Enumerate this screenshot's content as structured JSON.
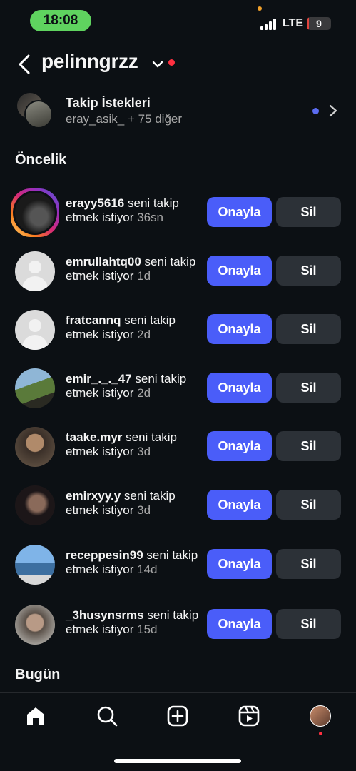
{
  "status": {
    "time": "18:08",
    "network": "LTE",
    "battery_level": "9",
    "battery_fraction": 0.09
  },
  "header": {
    "username": "pelinngrzz"
  },
  "follow_requests": {
    "title": "Takip İstekleri",
    "subtitle": "eray_asik_ + 75 diğer"
  },
  "sections": {
    "priority": "Öncelik",
    "today": "Bugün"
  },
  "buttons": {
    "approve": "Onayla",
    "delete": "Sil"
  },
  "requests": [
    {
      "username": "erayy5616",
      "message": " seni takip etmek istiyor ",
      "time": "36sn",
      "avatar": "story-photo"
    },
    {
      "username": "emrullahtq00",
      "message": " seni takip etmek istiyor ",
      "time": "1d",
      "avatar": "default"
    },
    {
      "username": "fratcannq",
      "message": " seni takip etmek istiyor ",
      "time": "2d",
      "avatar": "default"
    },
    {
      "username": "emir_._._47",
      "message": " seni takip etmek istiyor ",
      "time": "2d",
      "avatar": "photo"
    },
    {
      "username": "taake.myr",
      "message": " seni takip etmek istiyor ",
      "time": "3d",
      "avatar": "photo"
    },
    {
      "username": "emirxyy.y",
      "message": " seni takip etmek istiyor ",
      "time": "3d",
      "avatar": "photo"
    },
    {
      "username": "receppesin99",
      "message": " seni takip etmek istiyor ",
      "time": "14d",
      "avatar": "photo"
    },
    {
      "username": "_3husynsrms",
      "message": " seni takip etmek istiyor ",
      "time": "15d",
      "avatar": "photo"
    }
  ],
  "tabbar": {
    "icons": [
      "home-icon",
      "search-icon",
      "create-icon",
      "reels-icon",
      "profile-avatar"
    ]
  },
  "colors": {
    "background": "#0c1014",
    "approve": "#4a5df9",
    "delete": "#2c3137",
    "notification": "#ff3040",
    "unread": "#5b6cf0",
    "time_pill": "#5fd35f"
  }
}
